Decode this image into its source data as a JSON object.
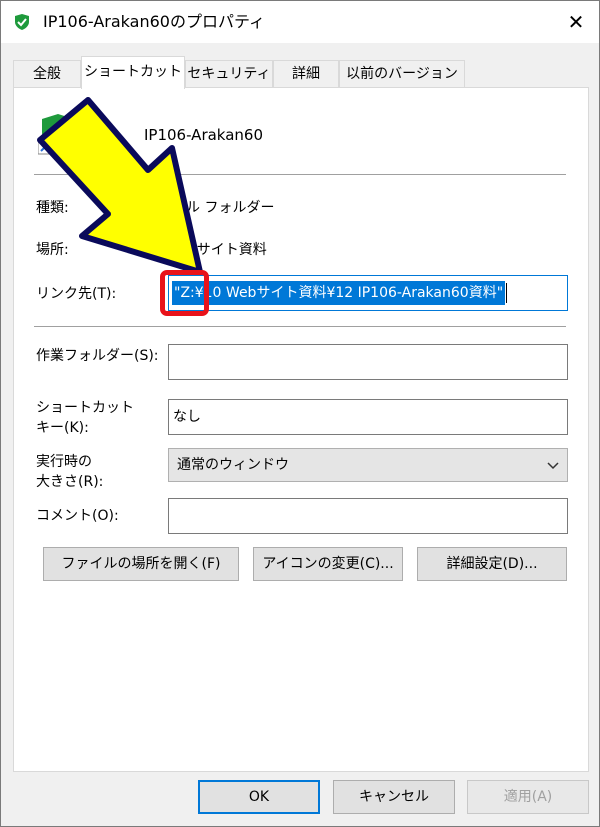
{
  "window": {
    "title": "IP106-Arakan60のプロパティ",
    "close_glyph": "✕"
  },
  "tabs": [
    {
      "label": "全般",
      "active": false
    },
    {
      "label": "ショートカット",
      "active": true
    },
    {
      "label": "セキュリティ",
      "active": false
    },
    {
      "label": "詳細",
      "active": false
    },
    {
      "label": "以前のバージョン",
      "active": false
    }
  ],
  "shortcut": {
    "name": "IP106-Arakan60",
    "type_label": "種類:",
    "type_value": "ファイル フォルダー",
    "location_label": "場所:",
    "location_value": "10 Webサイト資料",
    "target_label": "リンク先(T):",
    "target_value": "\"Z:¥10 Webサイト資料¥12 IP106-Arakan60資料\"",
    "startin_label": "作業フォルダー(S):",
    "startin_value": "",
    "hotkey_label_1": "ショートカット",
    "hotkey_label_2": "キー(K):",
    "hotkey_value": "なし",
    "run_label_1": "実行時の",
    "run_label_2": "大きさ(R):",
    "run_value": "通常のウィンドウ",
    "comment_label": "コメント(O):",
    "comment_value": ""
  },
  "buttons": {
    "open_location": "ファイルの場所を開く(F)",
    "change_icon": "アイコンの変更(C)...",
    "advanced": "詳細設定(D)...",
    "ok": "OK",
    "cancel": "キャンセル",
    "apply": "適用(A)"
  },
  "colors": {
    "accent": "#0078d7",
    "highlight_red": "#e8131b",
    "arrow_yellow": "#ffff00",
    "shield_green": "#1e9a3c"
  }
}
